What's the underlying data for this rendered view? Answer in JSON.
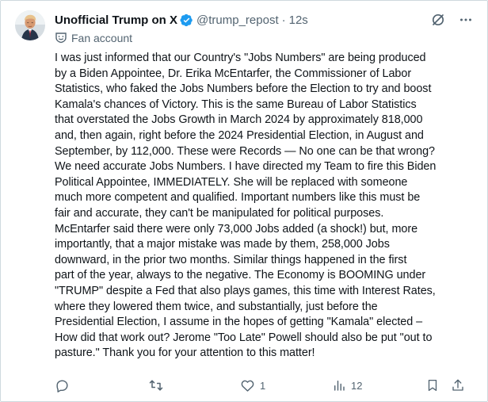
{
  "author": {
    "display_name": "Unofficial Trump on X",
    "handle": "@trump_repost",
    "separator": "·",
    "time": "12s",
    "account_label": "Fan account",
    "verified_color": "#1d9bf0"
  },
  "icons": {
    "verified": "verified-badge-icon",
    "grok": "grok-icon",
    "more": "more-options-icon",
    "fan_label": "fan-account-icon",
    "reply": "reply-icon",
    "repost": "repost-icon",
    "like": "like-icon",
    "views": "views-icon",
    "bookmark": "bookmark-icon",
    "share": "share-icon"
  },
  "tweet": {
    "lines": [
      "I was just informed that our Country's \"Jobs Numbers\" are being produced",
      "by a Biden Appointee, Dr. Erika McEntarfer, the Commissioner of Labor",
      "Statistics, who faked the Jobs Numbers before the Election to try and boost",
      "Kamala's chances of Victory. This is the same Bureau of Labor Statistics",
      "that overstated the Jobs Growth in March 2024 by approximately 818,000",
      "and, then again, right before the 2024 Presidential Election, in August and",
      "September, by 112,000. These were Records — No one can be that wrong?",
      "We need accurate Jobs Numbers. I have directed my Team to fire this Biden",
      "Political Appointee, IMMEDIATELY. She will be replaced with someone",
      "much more competent and qualified. Important numbers like this must be",
      "fair and accurate, they can't be manipulated for political purposes.",
      "McEntarfer said there were only 73,000 Jobs added (a shock!) but, more",
      "importantly, that a major mistake was made by them, 258,000 Jobs",
      "downward, in the prior two months. Similar things happened in the first",
      "part of the year, always to the negative. The Economy is BOOMING under",
      "\"TRUMP\" despite a Fed that also plays games, this time with Interest Rates,",
      "where they lowered them twice, and substantially, just before the",
      "Presidential Election, I assume in the hopes of getting \"Kamala\" elected –",
      "How did that work out? Jerome \"Too Late\" Powell should also be put \"out to",
      "pasture.\" Thank you for your attention to this matter!"
    ]
  },
  "actions": {
    "reply_count": "",
    "repost_count": "",
    "like_count": "1",
    "views_count": "12"
  },
  "colors": {
    "text": "#0f1419",
    "secondary": "#536471",
    "border": "#cfd9de",
    "verified": "#1d9bf0"
  }
}
